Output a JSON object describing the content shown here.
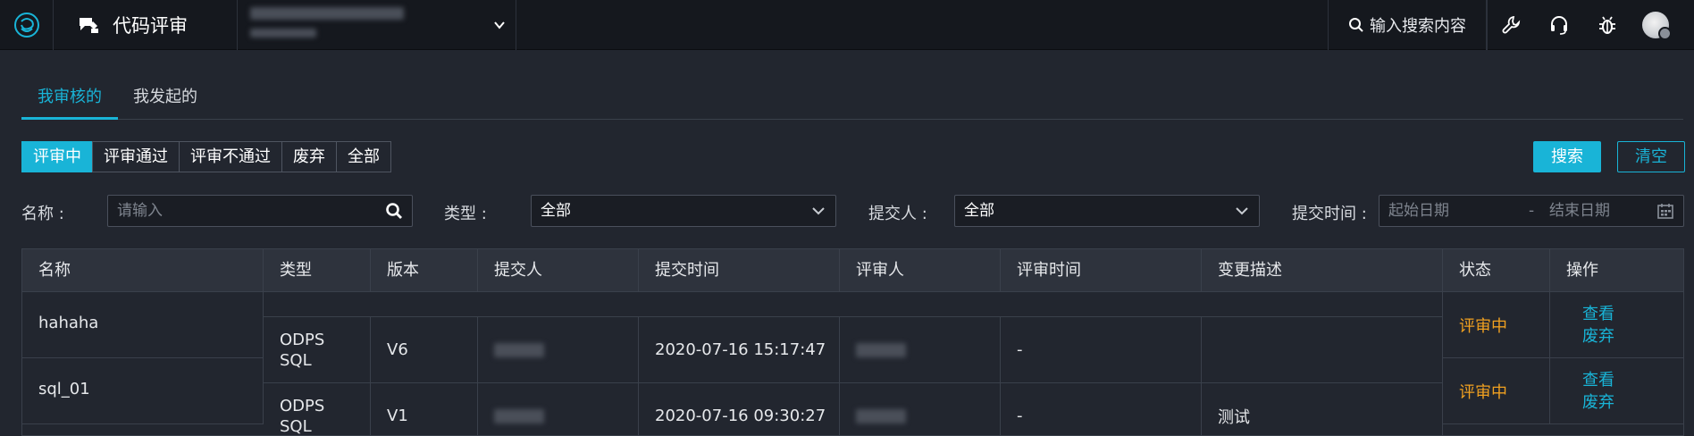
{
  "app": {
    "title": "代码评审"
  },
  "header": {
    "search_label": "输入搜索内容"
  },
  "tabs": [
    {
      "label": "我审核的",
      "active": true
    },
    {
      "label": "我发起的",
      "active": false
    }
  ],
  "status_filters": [
    {
      "label": "评审中",
      "active": true
    },
    {
      "label": "评审通过",
      "active": false
    },
    {
      "label": "评审不通过",
      "active": false
    },
    {
      "label": "废弃",
      "active": false
    },
    {
      "label": "全部",
      "active": false
    }
  ],
  "actions": {
    "search": "搜索",
    "clear": "清空"
  },
  "filters": {
    "name_label": "名称",
    "name_placeholder": "请输入",
    "type_label": "类型",
    "type_value": "全部",
    "submitter_label": "提交人",
    "submitter_value": "全部",
    "time_label": "提交时间",
    "start_placeholder": "起始日期",
    "end_placeholder": "结束日期",
    "date_separator": "-"
  },
  "table": {
    "columns": [
      "名称",
      "类型",
      "版本",
      "提交人",
      "提交时间",
      "评审人",
      "评审时间",
      "变更描述",
      "状态",
      "操作"
    ],
    "rows": [
      {
        "name": "hahaha",
        "type_line1": "ODPS",
        "type_line2": "SQL",
        "version": "V6",
        "submit_time": "2020-07-16 15:17:47",
        "review_time": "-",
        "description": "",
        "status": "评审中",
        "op_view": "查看",
        "op_discard": "废弃"
      },
      {
        "name": "sql_01",
        "type_line1": "ODPS",
        "type_line2": "SQL",
        "version": "V1",
        "submit_time": "2020-07-16 09:30:27",
        "review_time": "-",
        "description": "测试",
        "status": "评审中",
        "op_view": "查看",
        "op_discard": "废弃"
      }
    ]
  },
  "colors": {
    "accent": "#19b4d7",
    "status_pending": "#f0a020"
  }
}
